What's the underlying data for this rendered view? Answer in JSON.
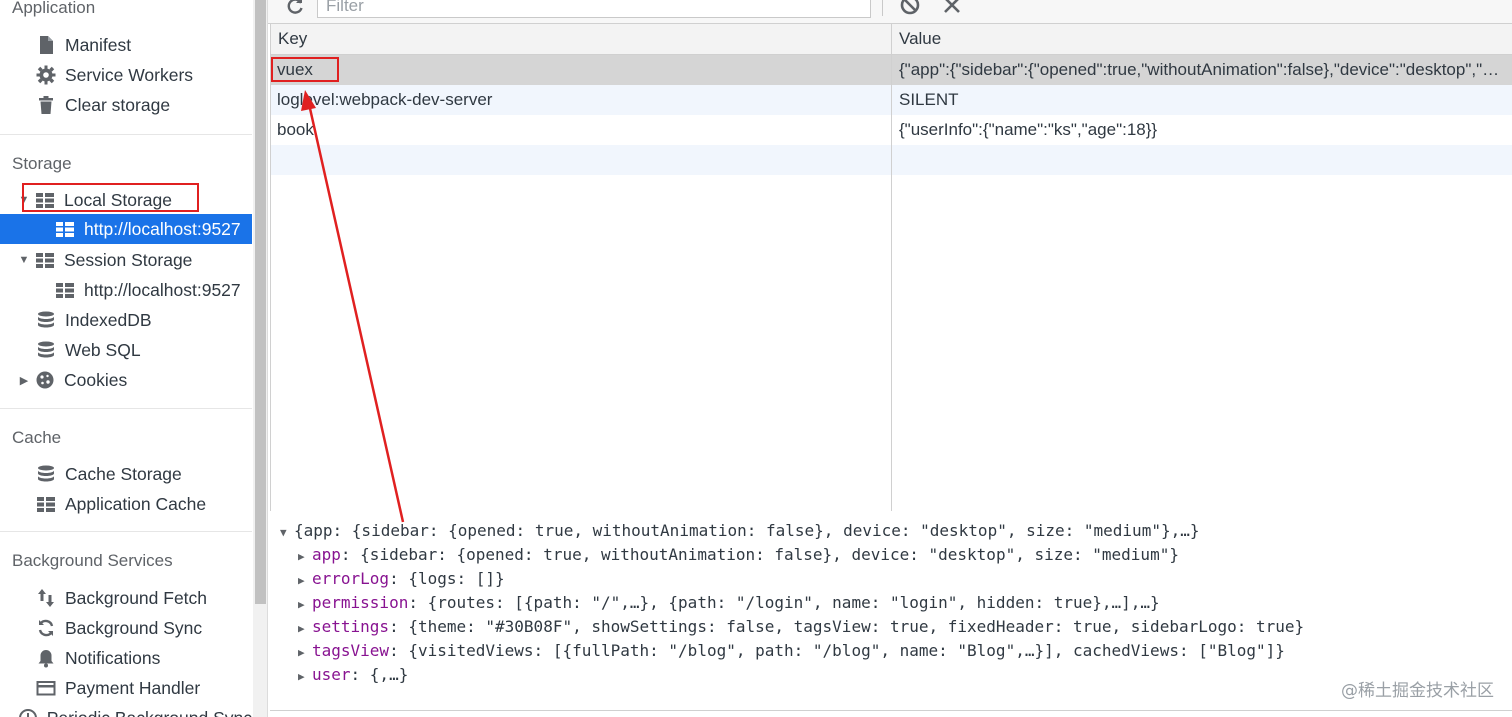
{
  "sidebar": {
    "app_header": "Application",
    "app_items": [
      "Manifest",
      "Service Workers",
      "Clear storage"
    ],
    "storage_header": "Storage",
    "local_storage": "Local Storage",
    "local_origin": "http://localhost:9527",
    "session_storage": "Session Storage",
    "session_origin": "http://localhost:9527",
    "indexeddb": "IndexedDB",
    "websql": "Web SQL",
    "cookies": "Cookies",
    "cache_header": "Cache",
    "cache_items": [
      "Cache Storage",
      "Application Cache"
    ],
    "bg_header": "Background Services",
    "bg_items": [
      "Background Fetch",
      "Background Sync",
      "Notifications",
      "Payment Handler",
      "Periodic Background Sync"
    ]
  },
  "toolbar": {
    "filter_placeholder": "Filter"
  },
  "table": {
    "key_header": "Key",
    "value_header": "Value",
    "rows": [
      {
        "key": "vuex",
        "value": "{\"app\":{\"sidebar\":{\"opened\":true,\"withoutAnimation\":false},\"device\":\"desktop\",\"size\":\"medium\"},\"errorLog\":{\"logs\":[]}}"
      },
      {
        "key": "loglevel:webpack-dev-server",
        "value": "SILENT"
      },
      {
        "key": "book",
        "value": "{\"userInfo\":{\"name\":\"ks\",\"age\":18}}"
      }
    ]
  },
  "preview": {
    "root": "{app: {sidebar: {opened: true, withoutAnimation: false}, device: \"desktop\", size: \"medium\"},…}",
    "props": [
      {
        "key": "app",
        "value": "{sidebar: {opened: true, withoutAnimation: false}, device: \"desktop\", size: \"medium\"}"
      },
      {
        "key": "errorLog",
        "value": "{logs: []}"
      },
      {
        "key": "permission",
        "value": "{routes: [{path: \"/\",…}, {path: \"/login\", name: \"login\", hidden: true},…],…}"
      },
      {
        "key": "settings",
        "value": "{theme: \"#30B08F\", showSettings: false, tagsView: true, fixedHeader: true, sidebarLogo: true}"
      },
      {
        "key": "tagsView",
        "value": "{visitedViews: [{fullPath: \"/blog\", path: \"/blog\", name: \"Blog\",…}], cachedViews: [\"Blog\"]}"
      },
      {
        "key": "user",
        "value": "{,…}"
      }
    ]
  },
  "watermark": "@稀土掘金技术社区",
  "colors": {
    "selection_blue": "#1a73e8",
    "annotation_red": "#e02020",
    "property_purple": "#881391"
  }
}
